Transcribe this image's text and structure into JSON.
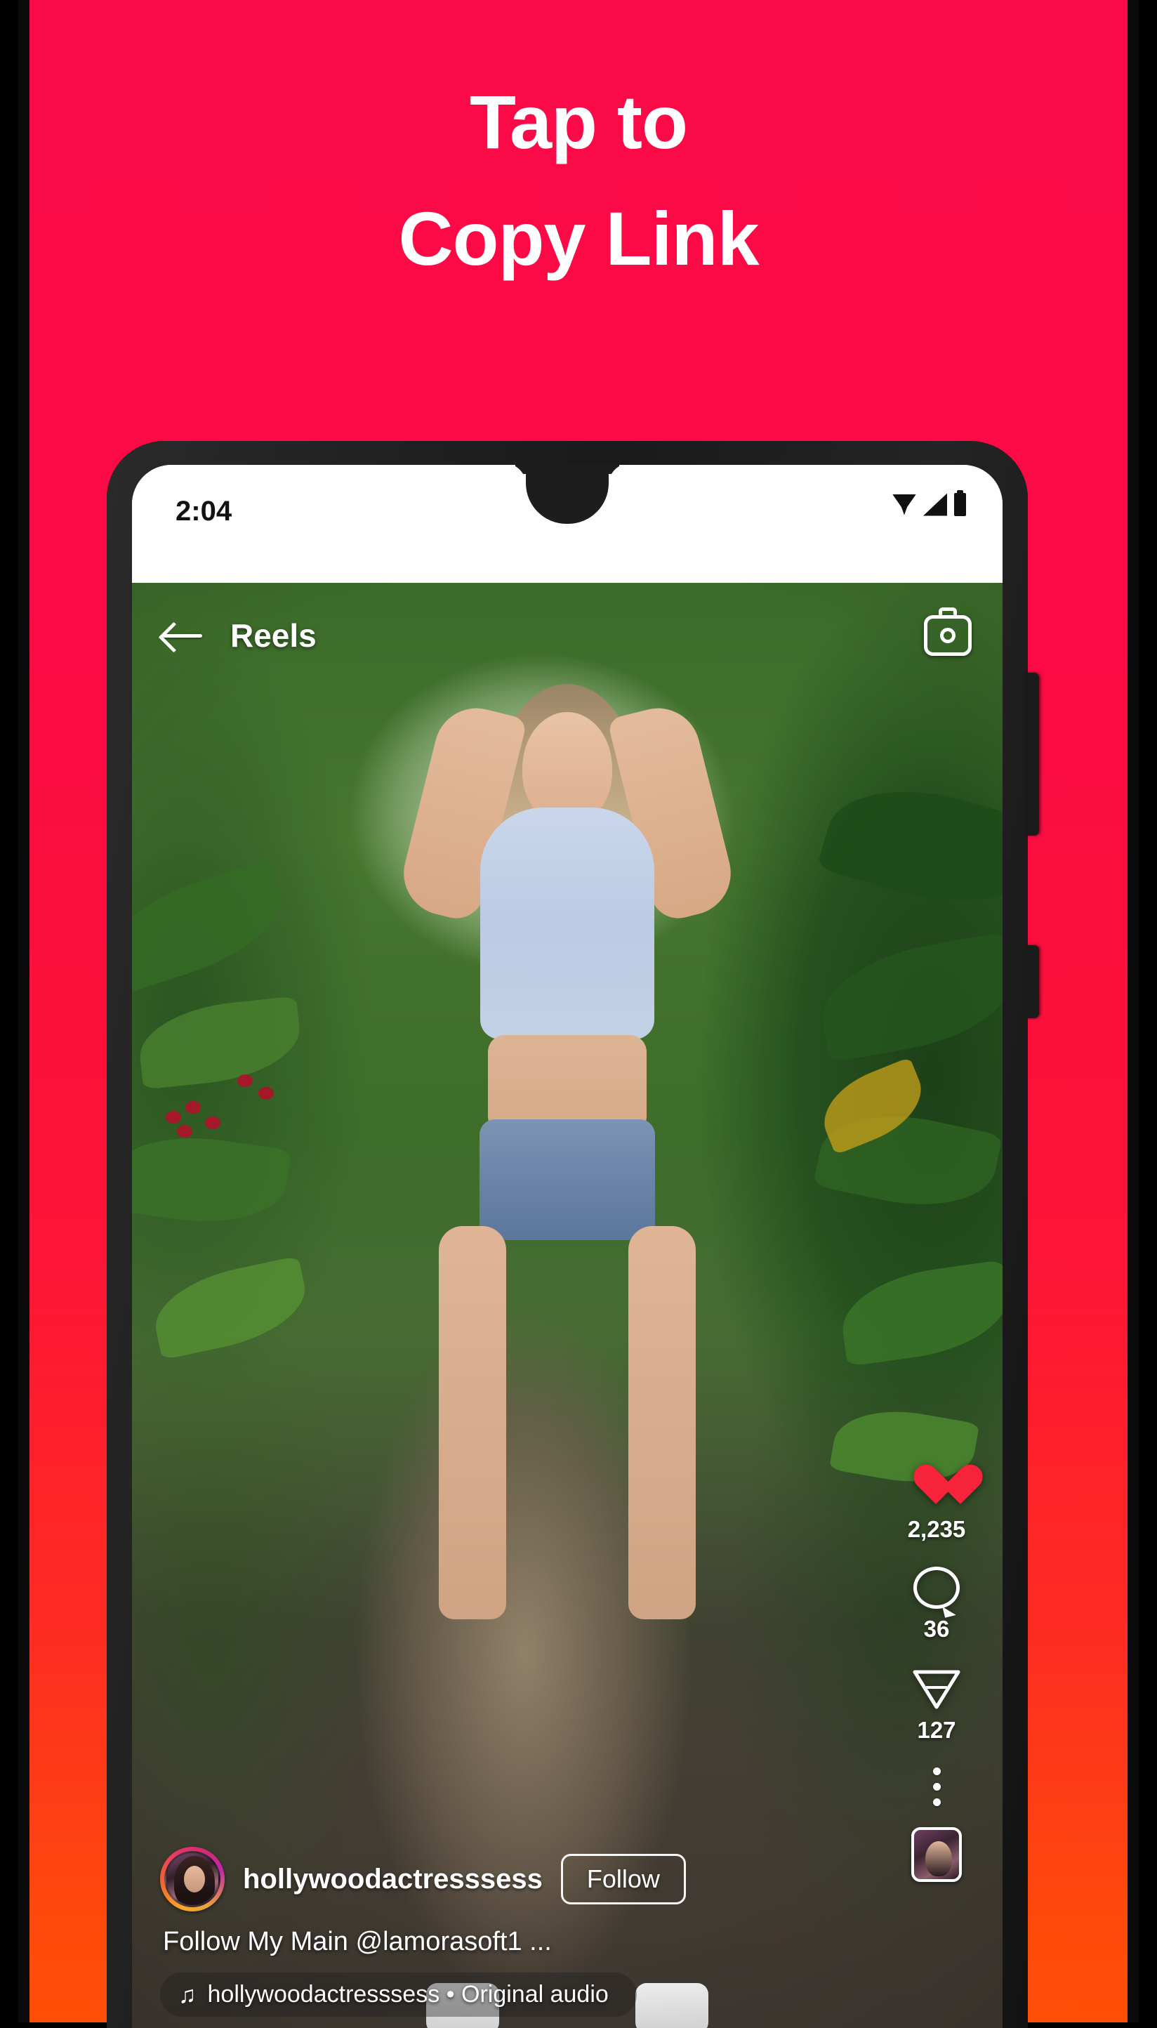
{
  "promo": {
    "headline_line1": "Tap to",
    "headline_line2": "Copy Link",
    "bg_top_color": "#FA0A47",
    "bg_bottom_color": "#FF4E08"
  },
  "phone": {
    "status_bar": {
      "clock": "2:04",
      "icons": [
        "wifi-icon",
        "signal-icon",
        "battery-icon"
      ]
    },
    "side_buttons": {
      "volume_rocker": "volume-rocker",
      "power_button": "power-button"
    }
  },
  "app": {
    "header": {
      "back_icon": "back-arrow-icon",
      "title": "Reels",
      "camera_icon": "camera-icon"
    },
    "actions": {
      "like": {
        "icon": "heart-icon",
        "count": "2,235",
        "color": "#F6233B"
      },
      "comment": {
        "icon": "comment-bubble-icon",
        "count": "36"
      },
      "share": {
        "icon": "send-paper-plane-icon",
        "count": "127"
      },
      "more": {
        "icon": "more-vertical-icon"
      },
      "album": {
        "icon": "album-thumbnail"
      }
    },
    "post": {
      "username": "hollywoodactresssess",
      "follow_label": "Follow",
      "caption": "Follow My Main @lamorasoft1 ...",
      "music_icon": "♫",
      "audio": "hollywoodactresssess • Original audio",
      "avatar": "user-avatar"
    }
  }
}
